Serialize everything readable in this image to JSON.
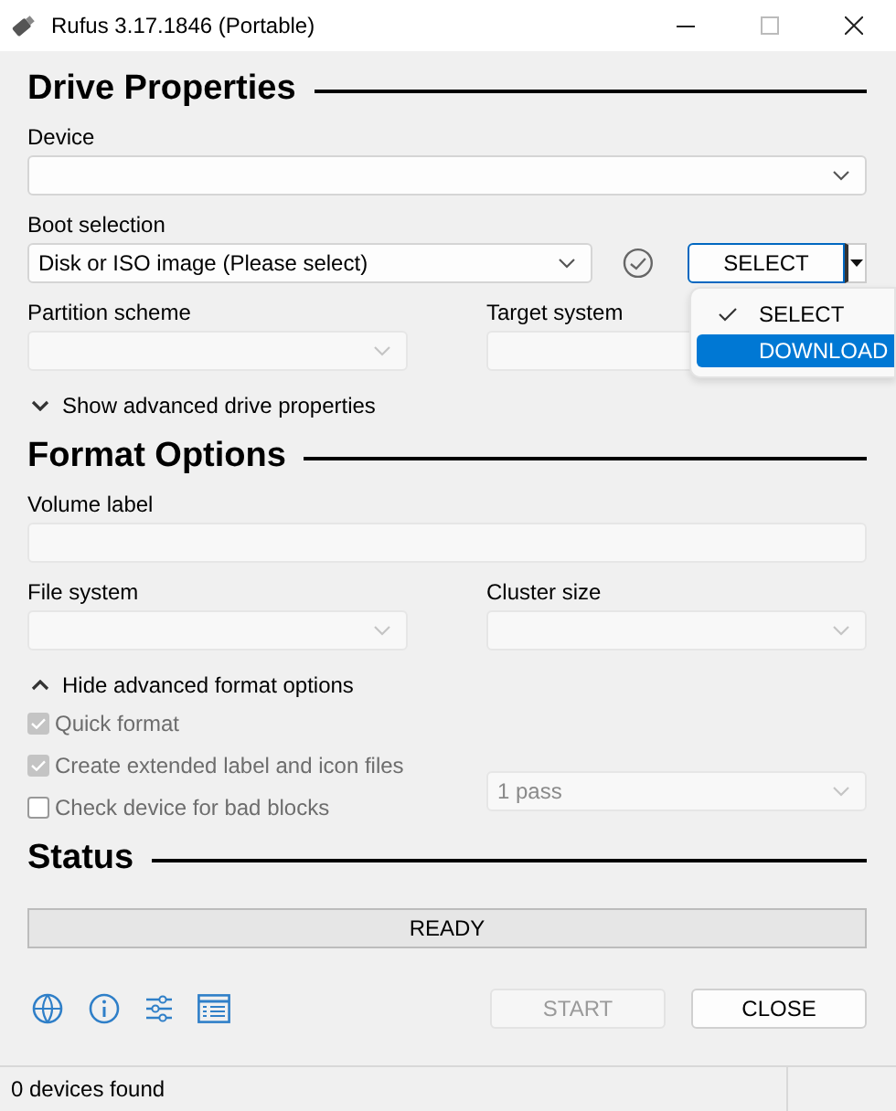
{
  "window": {
    "title": "Rufus 3.17.1846 (Portable)"
  },
  "drive_properties": {
    "heading": "Drive Properties",
    "device": {
      "label": "Device",
      "disabled": false
    },
    "boot_selection": {
      "label": "Boot selection",
      "value": "Disk or ISO image (Please select)",
      "disabled": false
    },
    "select_button": {
      "label": "SELECT"
    },
    "select_menu": [
      {
        "label": "SELECT",
        "checked": true,
        "selected": false
      },
      {
        "label": "DOWNLOAD",
        "checked": false,
        "selected": true
      }
    ],
    "partition_scheme": {
      "label": "Partition scheme",
      "disabled": true
    },
    "target_system": {
      "label": "Target system",
      "disabled": true
    },
    "advanced_toggle": {
      "label": "Show advanced drive properties",
      "expanded": false
    }
  },
  "format_options": {
    "heading": "Format Options",
    "volume_label": {
      "label": "Volume label",
      "disabled": true
    },
    "file_system": {
      "label": "File system",
      "disabled": true
    },
    "cluster_size": {
      "label": "Cluster size",
      "disabled": true
    },
    "advanced_toggle": {
      "label": "Hide advanced format options",
      "expanded": true
    },
    "checkboxes": [
      {
        "label": "Quick format",
        "checked": true,
        "disabled": true
      },
      {
        "label": "Create extended label and icon files",
        "checked": true,
        "disabled": true
      },
      {
        "label": "Check device for bad blocks",
        "checked": false,
        "disabled": true
      }
    ],
    "passes": {
      "value": "1 pass",
      "disabled": true
    }
  },
  "status": {
    "heading": "Status",
    "progress": {
      "text": "READY"
    }
  },
  "buttons": [
    {
      "label": "START",
      "disabled": true
    },
    {
      "label": "CLOSE",
      "disabled": false
    }
  ],
  "status_bar": {
    "text": "0 devices found"
  }
}
